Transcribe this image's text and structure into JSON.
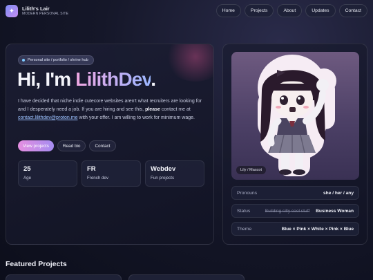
{
  "header": {
    "logo_icon": "sparkle-icon",
    "title": "Lilith's Lair",
    "subtitle": "MODERN PERSONAL SITE",
    "nav": [
      "Home",
      "Projects",
      "About",
      "Updates",
      "Contact"
    ]
  },
  "hero": {
    "tag": "Personal site / portfolio / shrine hub",
    "heading_plain": "Hi, I'm ",
    "heading_name": "LilithDev",
    "heading_end": ".",
    "intro_1": "I have decided that niche indie cutecore websites aren't what recruiters are looking for and I desperately need a job. If you are hiring and see this, ",
    "intro_bold": "please",
    "intro_2": " contact me at ",
    "email": "contact.lilithdev@proton.me",
    "intro_3": " with your offer. I am willing to work for minimum wage.",
    "buttons": {
      "view_projects": "View projects",
      "read_bio": "Read bio",
      "contact": "Contact"
    },
    "stats": [
      {
        "value": "25",
        "label": "Age"
      },
      {
        "value": "FR",
        "label": "French dev"
      },
      {
        "value": "Webdev",
        "label": "Fun projects"
      }
    ]
  },
  "profile": {
    "mascot_caption": "Lily / Mascot",
    "rows": [
      {
        "key": "Pronouns",
        "value": "she / her / any"
      },
      {
        "key": "Status",
        "struck": "Building silly cool stuff",
        "value": "Business Woman"
      },
      {
        "key": "Theme",
        "value": "Blue × Pink × White × Pink × Blue"
      }
    ]
  },
  "featured": {
    "title": "Featured Projects"
  },
  "colors": {
    "accent_pink": "#e58ee0",
    "accent_blue": "#9bb6ff",
    "background": "#151729"
  }
}
